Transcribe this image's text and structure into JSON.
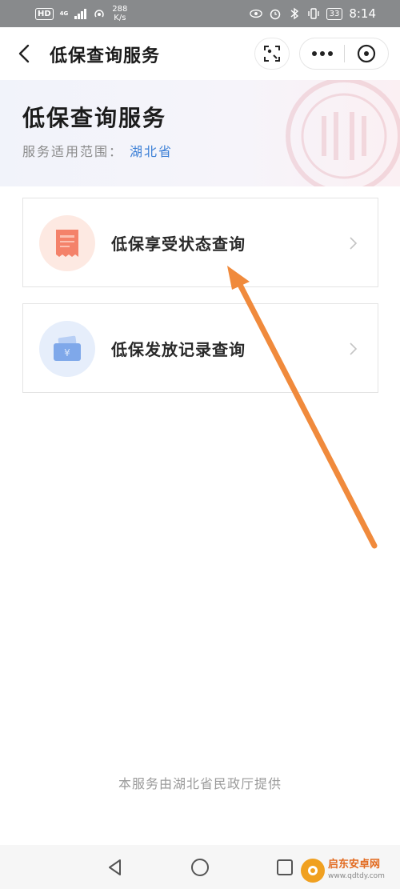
{
  "status_bar": {
    "hd": "HD",
    "net": "4G",
    "speed_value": "288",
    "speed_unit": "K/s",
    "battery": "33",
    "time": "8:14"
  },
  "nav": {
    "title": "低保查询服务"
  },
  "banner": {
    "title": "低保查询服务",
    "scope_label": "服务适用范围：",
    "scope_value": "湖北省"
  },
  "menu": [
    {
      "label": "低保享受状态查询",
      "icon": "receipt-icon"
    },
    {
      "label": "低保发放记录查询",
      "icon": "wallet-icon"
    }
  ],
  "footer": {
    "text": "本服务由湖北省民政厅提供"
  },
  "watermark": {
    "name": "启东安卓网",
    "url": "www.qdtdy.com"
  },
  "colors": {
    "accent_blue": "#3b7fd6",
    "arrow": "#f08a3c",
    "icon_orange": "#f4826a",
    "icon_blue": "#7fa8ea"
  }
}
